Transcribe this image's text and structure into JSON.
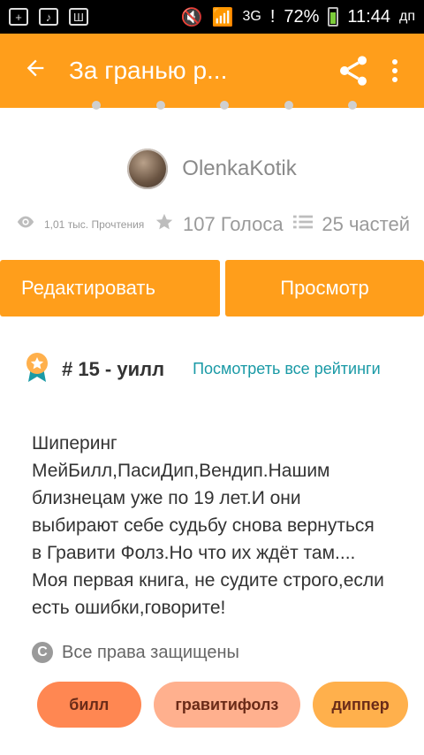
{
  "statusbar": {
    "network": "3G",
    "battery": "72%",
    "time": "11:44",
    "time_suffix": "дп"
  },
  "appbar": {
    "title": "За гранью р..."
  },
  "author": {
    "name": "OlenkaKotik"
  },
  "stats": {
    "reads": "1,01 тыс. Прочтения",
    "votes": "107 Голоса",
    "parts": "25 частей"
  },
  "buttons": {
    "edit": "Редактировать",
    "view": "Просмотр"
  },
  "ranking": {
    "text": "# 15 - уилл",
    "link": "Посмотреть все рейтинги"
  },
  "description": "Шиперинг\nМейБилл,ПасиДип,Вендип.Нашим\nблизнецам уже по 19 лет.И они\nвыбирают себе судьбу снова вернуться\nв Гравити Фолз.Но что их ждёт там....\nМоя первая книга, не судите строго,если\nесть ошибки,говорите!",
  "copyright": {
    "text": "Все права защищены"
  },
  "tags": [
    "билл",
    "гравитифолз",
    "диппер"
  ],
  "colors": {
    "accent": "#ff9e1b",
    "link": "#1a9aa6",
    "tag1": "#ff8752",
    "tag2": "#ffb08e",
    "tag3": "#ffb04c"
  }
}
